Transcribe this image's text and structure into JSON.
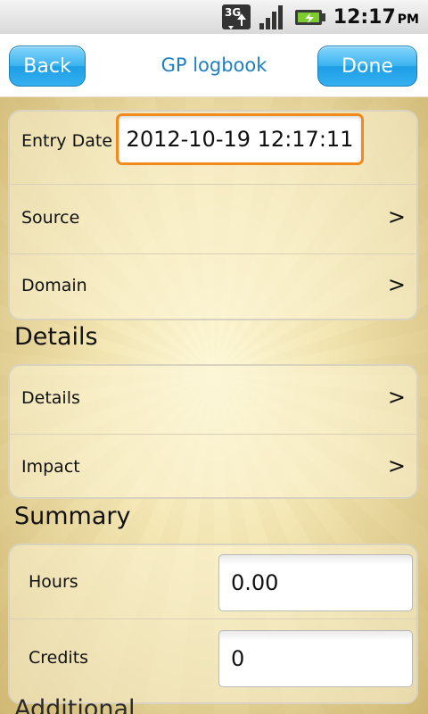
{
  "status_bar": {
    "network": "3G",
    "time": "12:17",
    "ampm": "PM"
  },
  "nav": {
    "back_label": "Back",
    "title": "GP logbook",
    "done_label": "Done"
  },
  "entry": {
    "entry_date_label": "Entry Date",
    "entry_date_value": "2012-10-19 12:17:11",
    "source_label": "Source",
    "domain_label": "Domain",
    "chevron": ">"
  },
  "details_section": {
    "header": "Details",
    "details_label": "Details",
    "impact_label": "Impact",
    "chevron": ">"
  },
  "summary_section": {
    "header": "Summary",
    "hours_label": "Hours",
    "hours_value": "0.00",
    "credits_label": "Credits",
    "credits_value": "0"
  },
  "additional_section": {
    "header": "Additional"
  },
  "colors": {
    "accent_blue": "#1e7fc2",
    "button_blue": "#34b0f0",
    "focus_orange": "#f08a1c"
  }
}
